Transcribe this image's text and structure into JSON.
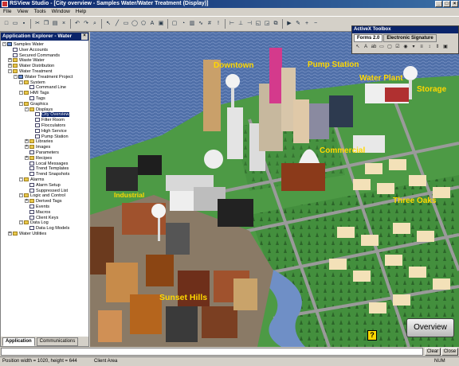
{
  "window": {
    "title": "RSView Studio - [City overview - Samples Water/Water Treatment (Display)]",
    "buttons": [
      "_",
      "□",
      "×"
    ]
  },
  "menu": [
    "File",
    "View",
    "Tools",
    "Window",
    "Help"
  ],
  "explorer": {
    "title": "Application Explorer - Water Treatment",
    "close": "×",
    "tree": [
      {
        "label": "Samples Water",
        "level": 0,
        "box": "-",
        "icon": "blue"
      },
      {
        "label": "User Accounts",
        "level": 1,
        "box": "",
        "icon": "doc"
      },
      {
        "label": "Secured Commands",
        "level": 1,
        "box": "",
        "icon": "doc"
      },
      {
        "label": "Waste Water",
        "level": 1,
        "box": "+",
        "icon": "folder"
      },
      {
        "label": "Water Distribution",
        "level": 1,
        "box": "+",
        "icon": "folder"
      },
      {
        "label": "Water Treatment",
        "level": 1,
        "box": "-",
        "icon": "folder"
      },
      {
        "label": "Water Treatment Project",
        "level": 2,
        "box": "-",
        "icon": "blue"
      },
      {
        "label": "System",
        "level": 3,
        "box": "-",
        "icon": "folder"
      },
      {
        "label": "Command Line",
        "level": 4,
        "box": "",
        "icon": "doc"
      },
      {
        "label": "HMI Tags",
        "level": 3,
        "box": "-",
        "icon": "folder"
      },
      {
        "label": "Tags",
        "level": 4,
        "box": "",
        "icon": "doc"
      },
      {
        "label": "Graphics",
        "level": 3,
        "box": "-",
        "icon": "folder"
      },
      {
        "label": "Displays",
        "level": 4,
        "box": "-",
        "icon": "folder"
      },
      {
        "label": "City Overview",
        "level": 5,
        "box": "",
        "icon": "doc",
        "selected": true
      },
      {
        "label": "Filter Room",
        "level": 5,
        "box": "",
        "icon": "doc"
      },
      {
        "label": "Flocculators",
        "level": 5,
        "box": "",
        "icon": "doc"
      },
      {
        "label": "High Service",
        "level": 5,
        "box": "",
        "icon": "doc"
      },
      {
        "label": "Pump Station",
        "level": 5,
        "box": "",
        "icon": "doc"
      },
      {
        "label": "Libraries",
        "level": 4,
        "box": "+",
        "icon": "folder"
      },
      {
        "label": "Images",
        "level": 4,
        "box": "+",
        "icon": "folder"
      },
      {
        "label": "Parameters",
        "level": 4,
        "box": "",
        "icon": "doc"
      },
      {
        "label": "Recipes",
        "level": 4,
        "box": "+",
        "icon": "folder"
      },
      {
        "label": "Local Messages",
        "level": 4,
        "box": "",
        "icon": "doc"
      },
      {
        "label": "Trend Templates",
        "level": 4,
        "box": "",
        "icon": "doc"
      },
      {
        "label": "Trend Snapshots",
        "level": 4,
        "box": "",
        "icon": "doc"
      },
      {
        "label": "Alarms",
        "level": 3,
        "box": "-",
        "icon": "folder"
      },
      {
        "label": "Alarm Setup",
        "level": 4,
        "box": "",
        "icon": "doc"
      },
      {
        "label": "Suppressed List",
        "level": 4,
        "box": "",
        "icon": "doc"
      },
      {
        "label": "Logic and Control",
        "level": 3,
        "box": "-",
        "icon": "folder"
      },
      {
        "label": "Derived Tags",
        "level": 4,
        "box": "+",
        "icon": "folder"
      },
      {
        "label": "Events",
        "level": 4,
        "box": "",
        "icon": "doc"
      },
      {
        "label": "Macros",
        "level": 4,
        "box": "",
        "icon": "doc"
      },
      {
        "label": "Client Keys",
        "level": 4,
        "box": "",
        "icon": "doc"
      },
      {
        "label": "Data Log",
        "level": 3,
        "box": "-",
        "icon": "folder"
      },
      {
        "label": "Data Log Models",
        "level": 4,
        "box": "",
        "icon": "doc"
      },
      {
        "label": "Water Utilities",
        "level": 1,
        "box": "+",
        "icon": "folder"
      }
    ],
    "tabs": [
      "Application",
      "Communications"
    ]
  },
  "toolbox": {
    "title": "ActiveX Toolbox",
    "tabs": [
      "Forms 2.0",
      "Electronic Signature"
    ],
    "icons": [
      "pointer-icon",
      "label-icon",
      "textbox-icon",
      "frame-icon",
      "button-icon",
      "check-icon",
      "radio-icon",
      "combo-icon",
      "list-icon",
      "scroll-icon",
      "spin-icon",
      "image-icon"
    ]
  },
  "scene": {
    "labels": {
      "downtown": "Downtown",
      "pump_station": "Pump Station",
      "water_plant": "Water Plant",
      "storage": "Storage",
      "commercial": "Commercial",
      "industrial": "Industrial",
      "three_oaks": "Three Oaks",
      "sunset_hills": "Sunset Hills"
    },
    "overview_button": "Overview",
    "help_icon": "?"
  },
  "command": {
    "value": "",
    "clear": "Clear",
    "close": "Close"
  },
  "status": {
    "position": "Position width = 1020, height = 644",
    "area": "Client Area",
    "num": "NUM"
  },
  "colors": {
    "label": "#ffd800",
    "water": "#4f6fa8",
    "grass": "#3f8a3a",
    "titlebar": "#0a246a"
  }
}
